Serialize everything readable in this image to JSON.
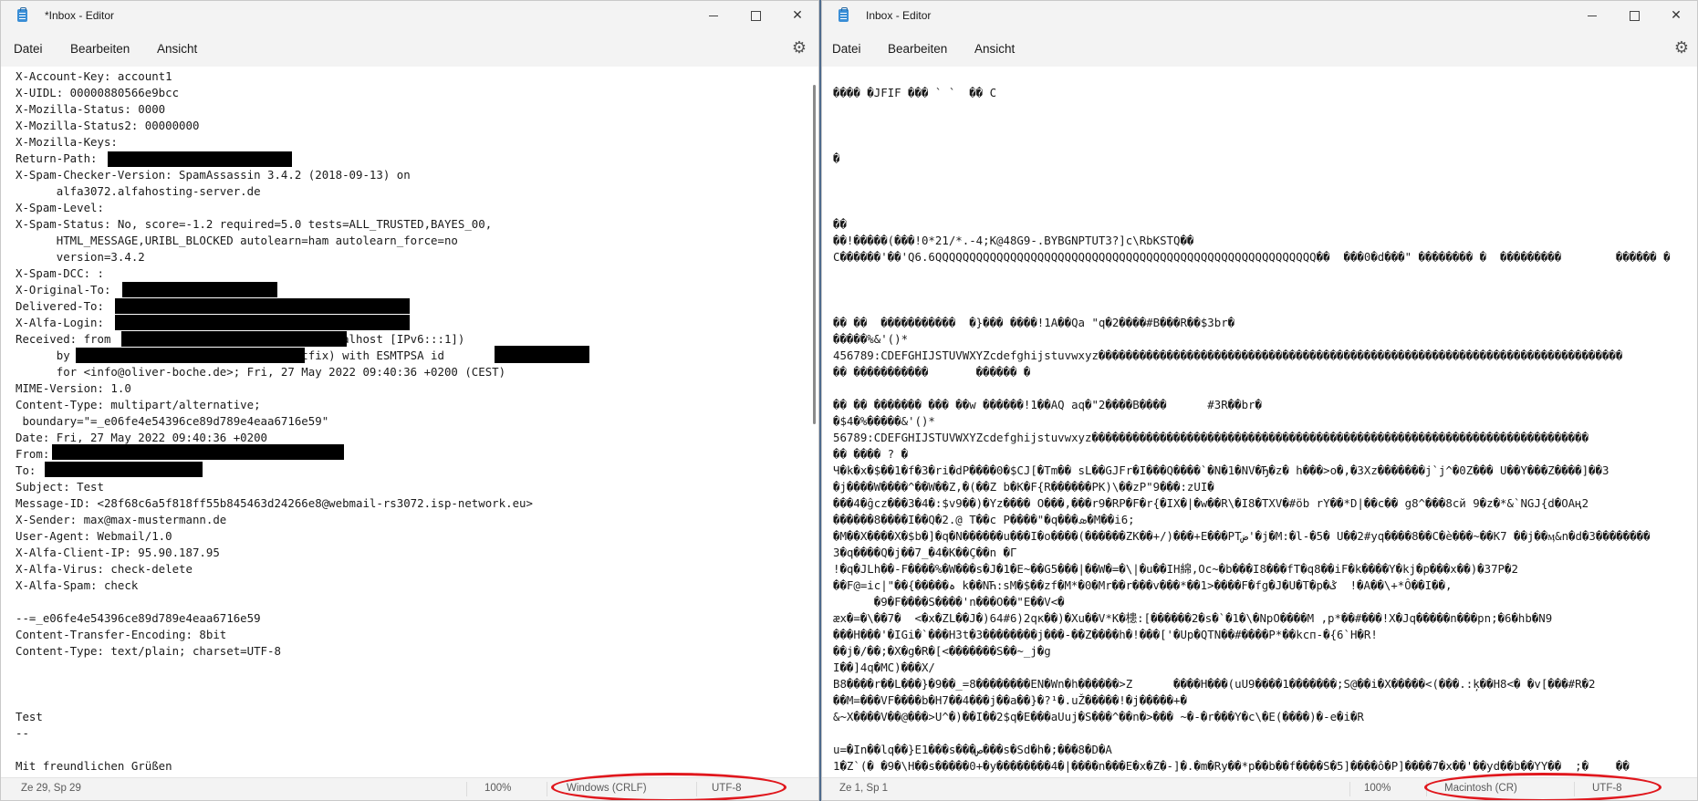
{
  "left_window": {
    "title": "*Inbox - Editor",
    "menu": [
      "Datei",
      "Bearbeiten",
      "Ansicht"
    ],
    "lines": [
      "X-Account-Key: account1",
      "X-UIDL: 00000880566e9bcc",
      "X-Mozilla-Status: 0000",
      "X-Mozilla-Status2: 00000000",
      "X-Mozilla-Keys:",
      "Return-Path: ",
      "X-Spam-Checker-Version: SpamAssassin 3.4.2 (2018-09-13) on",
      "      alfa3072.alfahosting-server.de",
      "X-Spam-Level:",
      "X-Spam-Status: No, score=-1.2 required=5.0 tests=ALL_TRUSTED,BAYES_00,",
      "      HTML_MESSAGE,URIBL_BLOCKED autolearn=ham autolearn_force=no",
      "      version=3.4.2",
      "X-Spam-DCC: :",
      "X-Original-To: ",
      "Delivered-To: ",
      "X-Alfa-Login: ",
      "Received: from                              (localhost [IPv6:::1])",
      "      by                              (Postfix) with ESMTPSA id",
      "      for <info@oliver-boche.de>; Fri, 27 May 2022 09:40:36 +0200 (CEST)",
      "MIME-Version: 1.0",
      "Content-Type: multipart/alternative;",
      " boundary=\"=_e06fe4e54396ce89d789e4eaa6716e59\"",
      "Date: Fri, 27 May 2022 09:40:36 +0200",
      "From: ",
      "To: ",
      "Subject: Test",
      "Message-ID: <28f68c6a5f818ff55b845463d24266e8@webmail-rs3072.isp-network.eu>",
      "X-Sender: max@max-mustermann.de",
      "User-Agent: Webmail/1.0",
      "X-Alfa-Client-IP: 95.90.187.95",
      "X-Alfa-Virus: check-delete",
      "X-Alfa-Spam: check",
      "",
      "--=_e06fe4e54396ce89d789e4eaa6716e59",
      "Content-Transfer-Encoding: 8bit",
      "Content-Type: text/plain; charset=UTF-8",
      "",
      "",
      "",
      "Test",
      "--",
      "",
      "Mit freundlichen Grüßen"
    ],
    "status": {
      "position": "Ze 29, Sp 29",
      "zoom": "100%",
      "line_ending": "Windows (CRLF)",
      "encoding": "UTF-8"
    }
  },
  "right_window": {
    "title": "Inbox - Editor",
    "menu": [
      "Datei",
      "Bearbeiten",
      "Ansicht"
    ],
    "lines": [
      "",
      "���� �JFIF ��� ` `  �� C",
      "",
      "",
      "",
      "�",
      "",
      "",
      "",
      "��",
      "��!�����(���!0*21/*.-4;K@48G9-.BYBGNPTUT3?]c\\RbKSTQ��",
      "C������'��'Q6.6QQQQQQQQQQQQQQQQQQQQQQQQQQQQQQQQQQQQQQQQQQQQQQQQQQQQQQQQ��  ���0�d���\" �������� �  ���������        ������ �",
      "",
      "",
      "",
      "�� ��  �����������  �}��� ����!1A��Qa \"q�2����#B���R��$3br�",
      "�����%&'()*",
      "456789:CDEFGHIJSTUVWXYZcdefghijstuvwxyz�����������������������������������������������������������������������������",
      "�� �����������       ������ �",
      "",
      "�� �� ������� ��� ��w ������!1��AQ aq�\"2����B����      #3R��br�",
      "�$4�%�����&'()*",
      "56789:CDEFGHIJSTUVWXYZcdefghijstuvwxyz�������������������������������������������������������������������������",
      "�� ���� ? �",
      "Ч�k�x�$��1�f�3�ri�dP����0�$CJ[�Tm�� sL��GJFr�I���Q����`�N�1�NV�Ђ�z� h���>o�,�3Xz�������j`j^�0Z��� U��Y���Z����]��3",
      "�j����W����^��W��Z,�(��Z b�K�F{R������PK)\\��zP\"9���:zUI�",
      "���4�ĝcz���3�4�:$v9��)�Yz���� O���,���r9�RP�F�r{�IX�|�w��R\\�I8�TXV�#öb rY��*D|��c�� g8^���8cй 9�z�*&`NGJ{d�OAң2",
      "������8����I��Q�2.@ T��c P����\"�q���ܣ�M��i6;",
      "�M��X����X�$b�]�q�N������u���I�o����(������ZK��+/)���+E���PTض'�j�M:�l-�5� U��2#yq����8��C�è���~��K7 ��j��ӎ&n�d�3��������",
      "3�q����Q�j��7_�4�K��Ç��n �Г",
      "!�q�JLh��-F����%�W���s�J�1�E~��G5���|��W�=�\\|�u��ІH綿,Oc~�b���I8���fT�q8��iF�k����Y�kj�p���x��)�37P�2",
      "��F@=ic|\"��{�����ہ k��NЋ:sM�$��zf�M*�0�Mr��r���v���*��1>����F�fg�J�U�T�p�ݣ  !�A��\\+*Ô��I��,",
      "      �9�F����S����'n���O��\"E��V<�",
      "æx�=�\\��7�  <�x�ZL��J�)64#6)2qк��)�Xu��V*K�槵:[������2�s�`�1�\\�NpO����M ,p*��#���!X�Jq�����n���pn;�6�hb�N9",
      "���H���'�IGi�`���H3t�3��������j���-��Z����h�!���['�Up�QTN��#����P*��kcп-�{6`H�R!",
      "��j�/��;�X�g�R�[<�������S��~_j�g",
      "I��]4q�MC)���X/",
      "B8����r��L���}�9��_=8��������EN�Wn�h������>Z      ����H���(uU9����1�������;S@��i�X�����<(���.:ķ��H8<� �v[���#R�2",
      "��M=���VF����b�H7��4���j��a��}�?¹�.uŽ�����!�j�����+�",
      "&~X����V��@���>U^�)��I��2$q�E���aUuj�S���^��n�>��� ~�-�r���Y�c\\�E(����)�-e�i�R",
      "",
      "u=�In��lq��}E1���s���ص���s�Sd�h�;���8�D�A",
      "1�Z`(� �9�\\H��s�����0+�y��������4�|����n���E�x�Z�-]�.�m�Ry��*p��b��f����S�5]����ô�P]����7�x��'��yd��b��YY��  ;�    ��"
    ],
    "status": {
      "position": "Ze 1, Sp 1",
      "zoom": "100%",
      "line_ending": "Macintosh (CR)",
      "encoding": "UTF-8"
    }
  },
  "icons": {
    "app": "notepad-icon",
    "minimize": "minimize-icon",
    "maximize": "maximize-icon",
    "close": "close-icon",
    "settings": "gear-icon"
  },
  "colors": {
    "annotation": "#e0171d",
    "redaction": "#000000"
  }
}
